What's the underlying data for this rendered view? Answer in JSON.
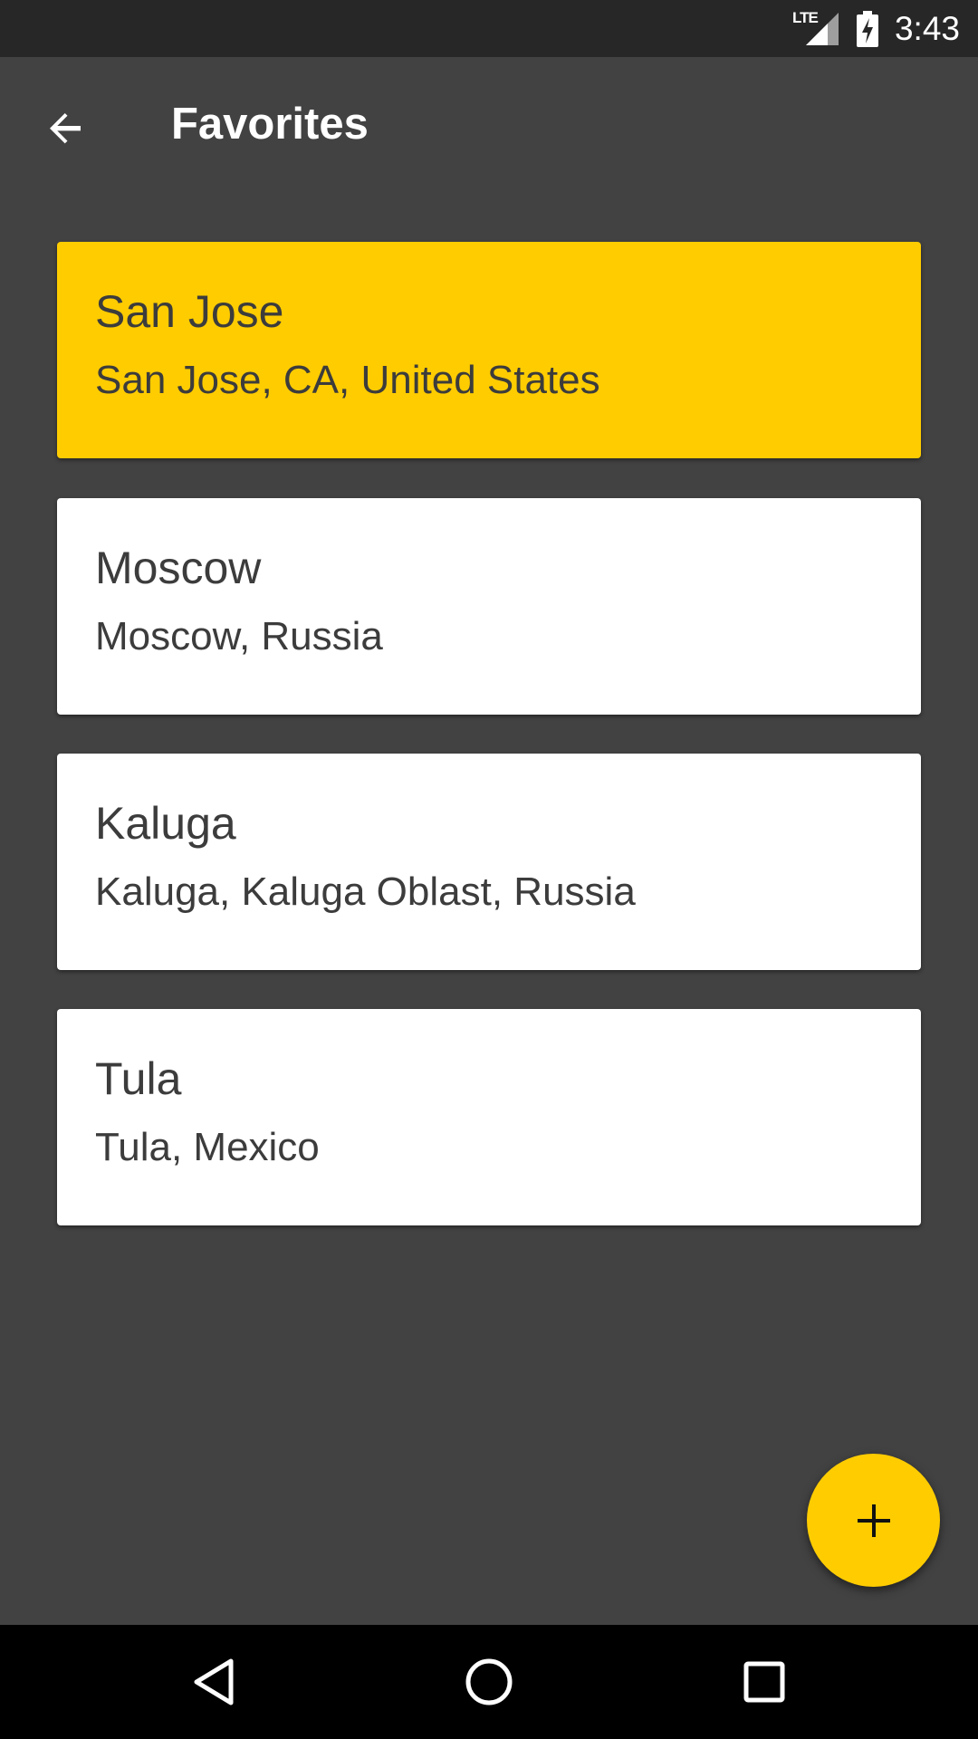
{
  "status_bar": {
    "network_label": "LTE",
    "time": "3:43",
    "icons": [
      "signal-icon",
      "battery-charging-icon"
    ]
  },
  "app_bar": {
    "title": "Favorites",
    "back_icon": "arrow-back-icon"
  },
  "favorites": [
    {
      "name": "San Jose",
      "address": "San Jose, CA, United States",
      "selected": true
    },
    {
      "name": "Moscow",
      "address": "Moscow, Russia",
      "selected": false
    },
    {
      "name": "Kaluga",
      "address": "Kaluga, Kaluga Oblast, Russia",
      "selected": false
    },
    {
      "name": "Tula",
      "address": "Tula, Mexico",
      "selected": false
    }
  ],
  "fab": {
    "icon": "plus-icon"
  },
  "nav_bar": {
    "icons": [
      "back-triangle-icon",
      "home-circle-icon",
      "recents-square-icon"
    ]
  },
  "colors": {
    "accent": "#ffcc00",
    "background": "#424242",
    "card": "#ffffff",
    "text": "#3c3c3c"
  }
}
